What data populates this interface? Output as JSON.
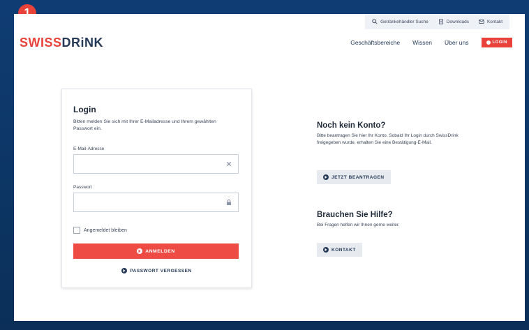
{
  "badge": "1",
  "brand": {
    "part1": "SWISS",
    "part2": "DRiNK"
  },
  "utility_nav": {
    "search": "Getränkehändler Suche",
    "downloads": "Downloads",
    "contact": "Kontakt"
  },
  "main_nav": {
    "items": [
      "Geschäftsbereiche",
      "Wissen",
      "Über uns"
    ],
    "login": "LOGIN"
  },
  "login_form": {
    "title": "Login",
    "intro": "Bitten melden Sie sich mit Ihrer E-Mailadresse und Ihrem gewählten Passwort ein.",
    "email_label": "E-Mail-Adresse",
    "email_value": "",
    "password_label": "Passwort",
    "password_value": "",
    "remember_label": "Angemeldet bleiben",
    "submit_label": "ANMELDEN",
    "forgot_label": "PASSWORT VERGESSEN"
  },
  "no_account": {
    "title": "Noch kein Konto?",
    "text": "Bitte beantragen Sie hier Ihr Konto. Sobald Ihr Login durch SwissDrink freigegeben wurde, erhalten Sie eine Bestätigung-E-Mail.",
    "button": "JETZT BEANTRAGEN"
  },
  "help": {
    "title": "Brauchen Sie Hilfe?",
    "text": "Bei Fragen helfen wir Ihnen gerne weiter.",
    "button": "KONTAKT"
  },
  "colors": {
    "accent": "#e8423a",
    "navy": "#263a57",
    "background": "#0f3c73"
  }
}
